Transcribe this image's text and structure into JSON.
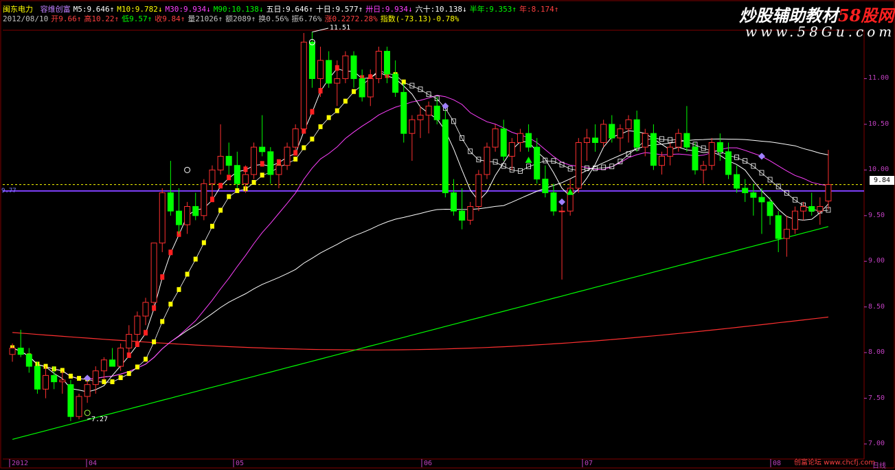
{
  "header": {
    "stock_name": "闽东电力",
    "line1": [
      {
        "text": "容维创富",
        "color": "#c080ff"
      },
      {
        "text": "M5:9.646↑",
        "color": "#ffffff"
      },
      {
        "text": "M10:9.782↓",
        "color": "#ffff00"
      },
      {
        "text": "M30:9.934↓",
        "color": "#ff40ff"
      },
      {
        "text": "M90:10.138↓",
        "color": "#00ff00"
      },
      {
        "text": "五日:9.646↑",
        "color": "#ffffff"
      },
      {
        "text": "十日:9.577↑",
        "color": "#ffffff"
      },
      {
        "text": "卅日:9.934↓",
        "color": "#ff40ff"
      },
      {
        "text": "六十:10.138↓",
        "color": "#ffffff"
      },
      {
        "text": "半年:9.353↑",
        "color": "#00ff00"
      },
      {
        "text": "年:8.174↑",
        "color": "#ff4040"
      }
    ],
    "line2": [
      {
        "text": "2012/08/10",
        "color": "#c0c0c0"
      },
      {
        "text": "开9.66↑",
        "color": "#ff4040"
      },
      {
        "text": "高10.22↑",
        "color": "#ff4040"
      },
      {
        "text": "低9.57↑",
        "color": "#00ff00"
      },
      {
        "text": "收9.84↑",
        "color": "#ff4040"
      },
      {
        "text": "量21026↑",
        "color": "#c0c0c0"
      },
      {
        "text": "额2089↑",
        "color": "#c0c0c0"
      },
      {
        "text": "换0.56%",
        "color": "#c0c0c0"
      },
      {
        "text": "振6.76%",
        "color": "#c0c0c0"
      },
      {
        "text": "涨0.2272.28%",
        "color": "#ff4040"
      },
      {
        "text": "指数(-73.13)-0.78%",
        "color": "#ffff00"
      }
    ]
  },
  "watermark": {
    "title_part1": "炒股辅助教材",
    "title_part2": "58股网",
    "url": "www.58Gu.com",
    "bottom": "创富论坛 www.chcfj.com"
  },
  "y_axis": {
    "labels": [
      "11.00",
      "10.50",
      "10.00",
      "9.50",
      "9.00",
      "8.50",
      "8.00",
      "7.50",
      "7.00"
    ],
    "min": 6.88,
    "max": 11.5
  },
  "x_axis": {
    "labels": [
      "2012",
      "04",
      "05",
      "06",
      "07",
      "08"
    ]
  },
  "price_markers": {
    "current_tag": "9.84",
    "left_price": "9.77",
    "high_label": "11.51",
    "low_label": "7.27",
    "bottom_right": "日线"
  },
  "colors": {
    "up": "#ff3030",
    "down": "#00ff00",
    "ma5": "#ffffff",
    "ma30": "#ff40ff",
    "ma90": "#ffffff",
    "half_year": "#00ff00",
    "year": "#ff3030",
    "price_line": "#8040ff",
    "dash_line": "#ffff00"
  },
  "chart_data": {
    "type": "candlestick",
    "date": "2012/08/10",
    "ohlc_last": {
      "open": 9.66,
      "high": 10.22,
      "low": 9.57,
      "close": 9.84
    },
    "candles": [
      [
        7.98,
        8.1,
        7.9,
        8.05
      ],
      [
        8.05,
        8.25,
        7.95,
        7.98
      ],
      [
        7.98,
        8.05,
        7.78,
        7.85
      ],
      [
        7.85,
        7.9,
        7.55,
        7.6
      ],
      [
        7.6,
        7.85,
        7.5,
        7.75
      ],
      [
        7.75,
        7.85,
        7.6,
        7.68
      ],
      [
        7.68,
        7.8,
        7.55,
        7.7
      ],
      [
        7.65,
        7.7,
        7.25,
        7.3
      ],
      [
        7.3,
        7.55,
        7.27,
        7.52
      ],
      [
        7.52,
        7.7,
        7.45,
        7.65
      ],
      [
        7.65,
        7.85,
        7.55,
        7.8
      ],
      [
        7.8,
        7.95,
        7.7,
        7.92
      ],
      [
        7.92,
        8.05,
        7.85,
        7.85
      ],
      [
        7.85,
        8.1,
        7.8,
        8.05
      ],
      [
        8.05,
        8.3,
        7.95,
        8.2
      ],
      [
        8.2,
        8.45,
        8.1,
        8.4
      ],
      [
        8.4,
        8.6,
        8.3,
        8.55
      ],
      [
        8.55,
        9.2,
        8.5,
        9.2
      ],
      [
        9.2,
        9.8,
        9.1,
        9.75
      ],
      [
        9.75,
        10.1,
        9.5,
        9.55
      ],
      [
        9.55,
        9.8,
        9.3,
        9.4
      ],
      [
        9.4,
        9.65,
        9.3,
        9.6
      ],
      [
        9.6,
        9.75,
        9.45,
        9.5
      ],
      [
        9.5,
        9.9,
        9.45,
        9.85
      ],
      [
        9.85,
        10.05,
        9.7,
        10.0
      ],
      [
        10.0,
        10.5,
        9.95,
        10.15
      ],
      [
        10.15,
        10.3,
        9.95,
        10.05
      ],
      [
        10.05,
        10.2,
        9.8,
        9.85
      ],
      [
        9.85,
        10.05,
        9.75,
        9.95
      ],
      [
        9.95,
        10.3,
        9.9,
        10.25
      ],
      [
        10.25,
        10.6,
        10.15,
        10.2
      ],
      [
        10.2,
        10.25,
        9.85,
        9.95
      ],
      [
        9.95,
        10.1,
        9.8,
        10.05
      ],
      [
        10.05,
        10.3,
        10.0,
        10.25
      ],
      [
        10.25,
        10.5,
        10.2,
        10.45
      ],
      [
        10.45,
        11.5,
        10.4,
        11.4
      ],
      [
        11.4,
        11.51,
        10.9,
        11.0
      ],
      [
        11.0,
        11.35,
        10.8,
        11.2
      ],
      [
        11.2,
        11.3,
        10.9,
        10.95
      ],
      [
        10.95,
        11.2,
        10.7,
        11.0
      ],
      [
        11.0,
        11.3,
        10.95,
        11.25
      ],
      [
        11.25,
        11.3,
        10.9,
        11.0
      ],
      [
        11.0,
        11.1,
        10.75,
        10.8
      ],
      [
        10.8,
        11.1,
        10.7,
        11.0
      ],
      [
        11.0,
        11.35,
        10.95,
        11.3
      ],
      [
        11.3,
        11.35,
        10.95,
        11.05
      ],
      [
        11.05,
        11.2,
        10.8,
        10.85
      ],
      [
        10.85,
        10.95,
        10.3,
        10.4
      ],
      [
        10.4,
        10.6,
        10.1,
        10.55
      ],
      [
        10.55,
        10.7,
        10.35,
        10.6
      ],
      [
        10.6,
        10.75,
        10.4,
        10.7
      ],
      [
        10.7,
        10.8,
        10.5,
        10.55
      ],
      [
        10.55,
        10.65,
        9.7,
        9.75
      ],
      [
        9.75,
        9.9,
        9.5,
        9.55
      ],
      [
        9.55,
        9.8,
        9.35,
        9.45
      ],
      [
        9.45,
        9.65,
        9.4,
        9.6
      ],
      [
        9.6,
        10.0,
        9.55,
        9.95
      ],
      [
        9.95,
        10.3,
        9.9,
        10.25
      ],
      [
        10.25,
        10.5,
        10.2,
        10.45
      ],
      [
        10.45,
        10.55,
        10.1,
        10.15
      ],
      [
        10.15,
        10.35,
        10.0,
        10.3
      ],
      [
        10.3,
        10.45,
        10.2,
        10.4
      ],
      [
        10.4,
        10.5,
        10.2,
        10.25
      ],
      [
        10.25,
        10.35,
        9.85,
        9.9
      ],
      [
        9.9,
        10.05,
        9.7,
        9.75
      ],
      [
        9.75,
        9.85,
        9.5,
        9.55
      ],
      [
        9.55,
        9.6,
        8.8,
        9.55
      ],
      [
        9.55,
        9.9,
        9.5,
        9.8
      ],
      [
        9.8,
        10.35,
        9.75,
        10.3
      ],
      [
        10.3,
        10.45,
        10.1,
        10.35
      ],
      [
        10.35,
        10.5,
        10.2,
        10.3
      ],
      [
        10.3,
        10.55,
        10.25,
        10.5
      ],
      [
        10.5,
        10.6,
        10.3,
        10.35
      ],
      [
        10.35,
        10.5,
        10.2,
        10.45
      ],
      [
        10.45,
        10.6,
        10.3,
        10.55
      ],
      [
        10.55,
        10.65,
        10.2,
        10.25
      ],
      [
        10.25,
        10.45,
        10.15,
        10.4
      ],
      [
        10.4,
        10.5,
        10.0,
        10.05
      ],
      [
        10.05,
        10.2,
        9.95,
        10.15
      ],
      [
        10.15,
        10.3,
        10.05,
        10.25
      ],
      [
        10.25,
        10.45,
        10.2,
        10.4
      ],
      [
        10.4,
        10.7,
        10.2,
        10.25
      ],
      [
        10.25,
        10.3,
        9.95,
        10.0
      ],
      [
        10.0,
        10.1,
        9.85,
        10.05
      ],
      [
        10.05,
        10.35,
        10.0,
        10.3
      ],
      [
        10.3,
        10.4,
        10.1,
        10.2
      ],
      [
        10.2,
        10.3,
        9.9,
        9.95
      ],
      [
        9.95,
        10.05,
        9.75,
        9.8
      ],
      [
        9.8,
        9.9,
        9.65,
        9.75
      ],
      [
        9.75,
        9.85,
        9.5,
        9.7
      ],
      [
        9.7,
        9.8,
        9.3,
        9.65
      ],
      [
        9.65,
        9.7,
        9.4,
        9.5
      ],
      [
        9.5,
        9.55,
        9.1,
        9.25
      ],
      [
        9.25,
        9.5,
        9.05,
        9.35
      ],
      [
        9.35,
        9.6,
        9.3,
        9.55
      ],
      [
        9.55,
        9.65,
        9.45,
        9.6
      ],
      [
        9.6,
        9.75,
        9.5,
        9.55
      ],
      [
        9.55,
        9.7,
        9.4,
        9.6
      ],
      [
        9.66,
        10.22,
        9.57,
        9.84
      ]
    ]
  }
}
